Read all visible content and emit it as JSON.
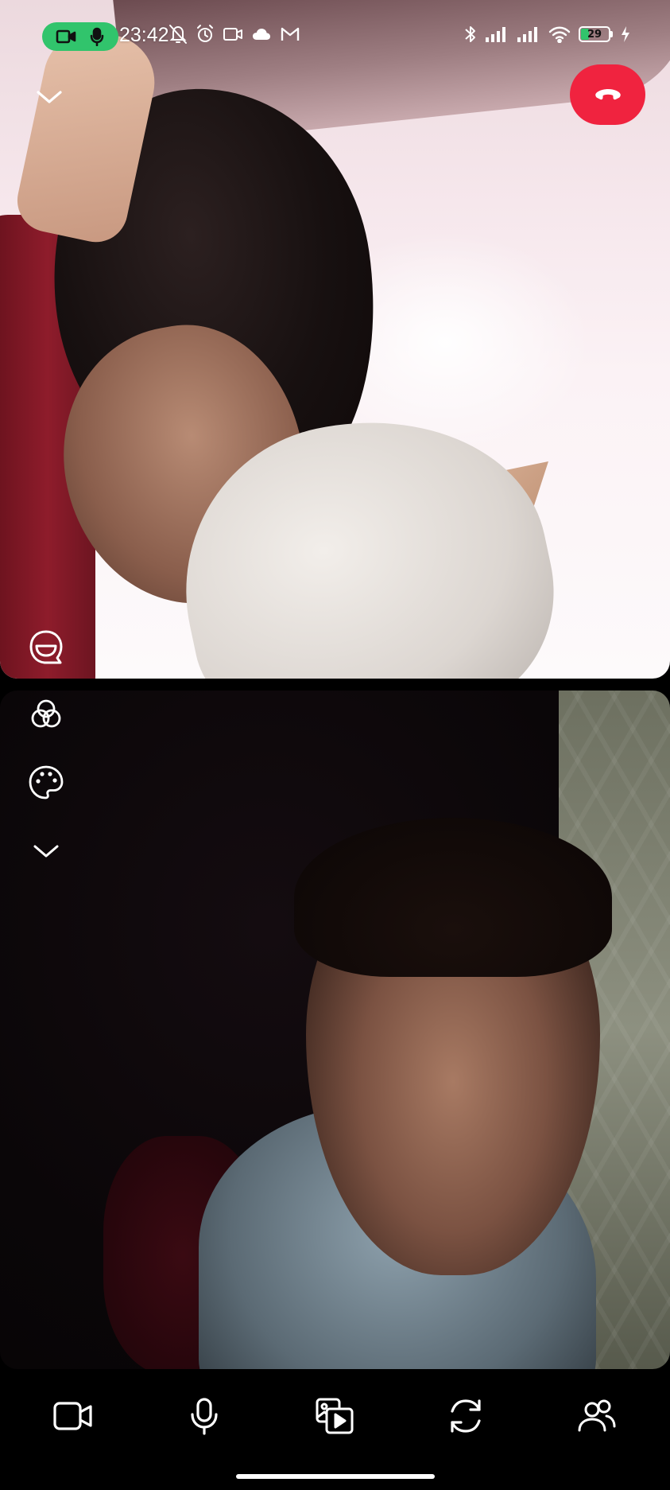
{
  "status_bar": {
    "time": "23:42",
    "battery_level": "29",
    "battery_fraction": 0.29,
    "left_icons": [
      "muted-bell-icon",
      "alarm-clock-icon",
      "video-icon",
      "cloud-icon",
      "gmail-icon"
    ],
    "right_icons": [
      "bluetooth-icon",
      "signal-icon",
      "signal-icon",
      "wifi-icon",
      "battery-icon",
      "charging-icon"
    ]
  },
  "recording_indicator": {
    "icons": [
      "camera-active-icon",
      "mic-active-icon"
    ],
    "color": "#31c46c"
  },
  "call": {
    "collapse_icon": "chevron-down-icon",
    "hangup_icon": "phone-hangup-icon",
    "hangup_color": "#f0233f"
  },
  "side_tools": [
    {
      "name": "lens-icon"
    },
    {
      "name": "palette-icon"
    },
    {
      "name": "chevron-down-icon"
    }
  ],
  "remote_tile_icon": "face-reaction-icon",
  "controls": [
    {
      "name": "camera-button",
      "icon": "video-camera-icon"
    },
    {
      "name": "microphone-button",
      "icon": "microphone-icon"
    },
    {
      "name": "media-button",
      "icon": "media-share-icon"
    },
    {
      "name": "flip-camera-button",
      "icon": "flip-camera-icon"
    },
    {
      "name": "participants-button",
      "icon": "people-icon"
    }
  ]
}
